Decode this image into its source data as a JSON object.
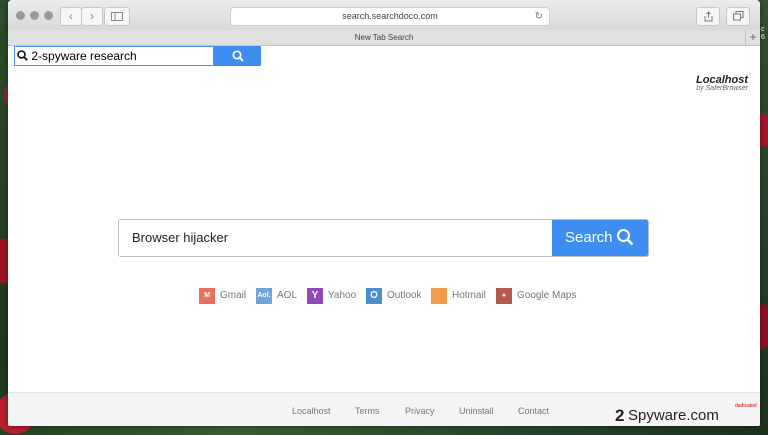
{
  "browser": {
    "url": "search.searchdoco.com",
    "tab_title": "New Tab Search",
    "new_tab_symbol": "+",
    "back_symbol": "‹",
    "forward_symbol": "›"
  },
  "top_search": {
    "query": "2-spyware research"
  },
  "brand": {
    "name": "Localhost",
    "by": "by SaferBrowser"
  },
  "main_search": {
    "query": "Browser hijacker",
    "button_label": "Search"
  },
  "quick_links": [
    {
      "label": "Gmail",
      "icon": "gmail-icon",
      "color": "#e8705f",
      "glyph": "M"
    },
    {
      "label": "AOL",
      "icon": "aol-icon",
      "color": "#6fa5d8",
      "glyph": "Aol."
    },
    {
      "label": "Yahoo",
      "icon": "yahoo-icon",
      "color": "#8d4bb8",
      "glyph": "Y"
    },
    {
      "label": "Outlook",
      "icon": "outlook-icon",
      "color": "#4c8fd1",
      "glyph": "O"
    },
    {
      "label": "Hotmail",
      "icon": "hotmail-icon",
      "color": "#f29b4a",
      "glyph": ""
    },
    {
      "label": "Google Maps",
      "icon": "google-maps-icon",
      "color": "#b55a4e",
      "glyph": "●"
    }
  ],
  "footer": {
    "links": [
      "Localhost",
      "Terms",
      "Privacy",
      "Uninstall",
      "Contact"
    ]
  },
  "watermark": {
    "number": "2",
    "text": "Spyware.com",
    "tag": "dedicated"
  },
  "side_fragment": "c\n6"
}
